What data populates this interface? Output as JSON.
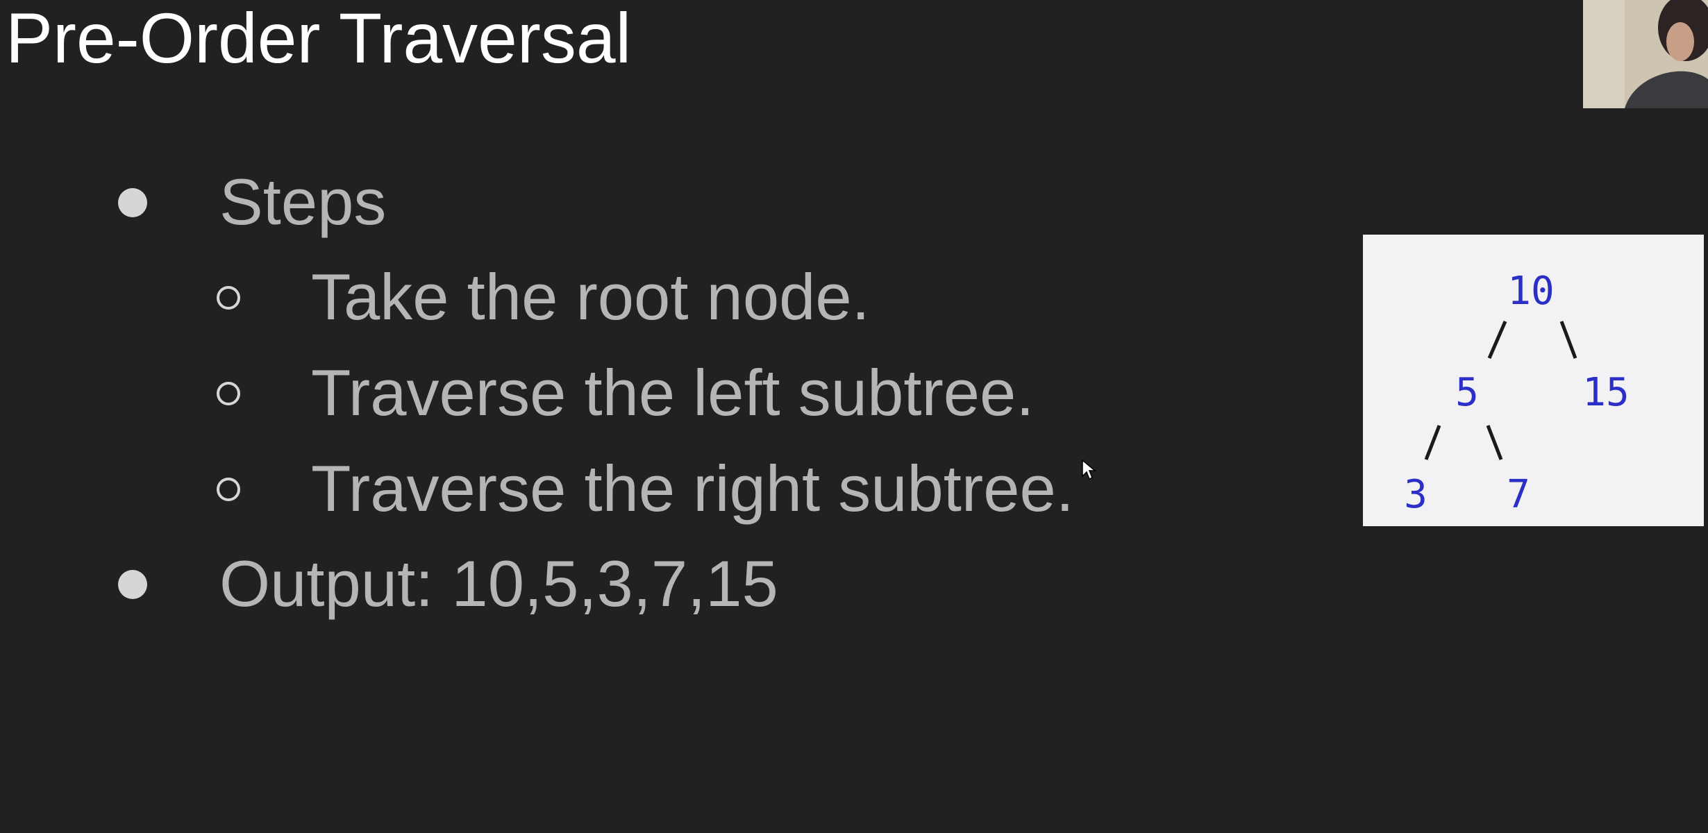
{
  "slide": {
    "title": "Pre-Order Traversal",
    "bullets": [
      {
        "text": "Steps"
      },
      {
        "text": "Output: 10,5,3,7,15"
      }
    ],
    "steps": [
      "Take the root node.",
      "Traverse the left subtree.",
      "Traverse the right subtree."
    ]
  },
  "tree": {
    "root": "10",
    "root_left": "5",
    "root_right": "15",
    "left_left": "3",
    "left_right": "7"
  },
  "colors": {
    "background": "#212121",
    "title": "#ffffff",
    "body_text": "#b5b5b5",
    "tree_node": "#2b2fc8",
    "tree_panel": "#f2f2f4"
  },
  "icons": {
    "bullet": "filled-circle-bullet-icon",
    "sub_bullet": "hollow-circle-bullet-icon",
    "cursor": "mouse-pointer-icon"
  }
}
